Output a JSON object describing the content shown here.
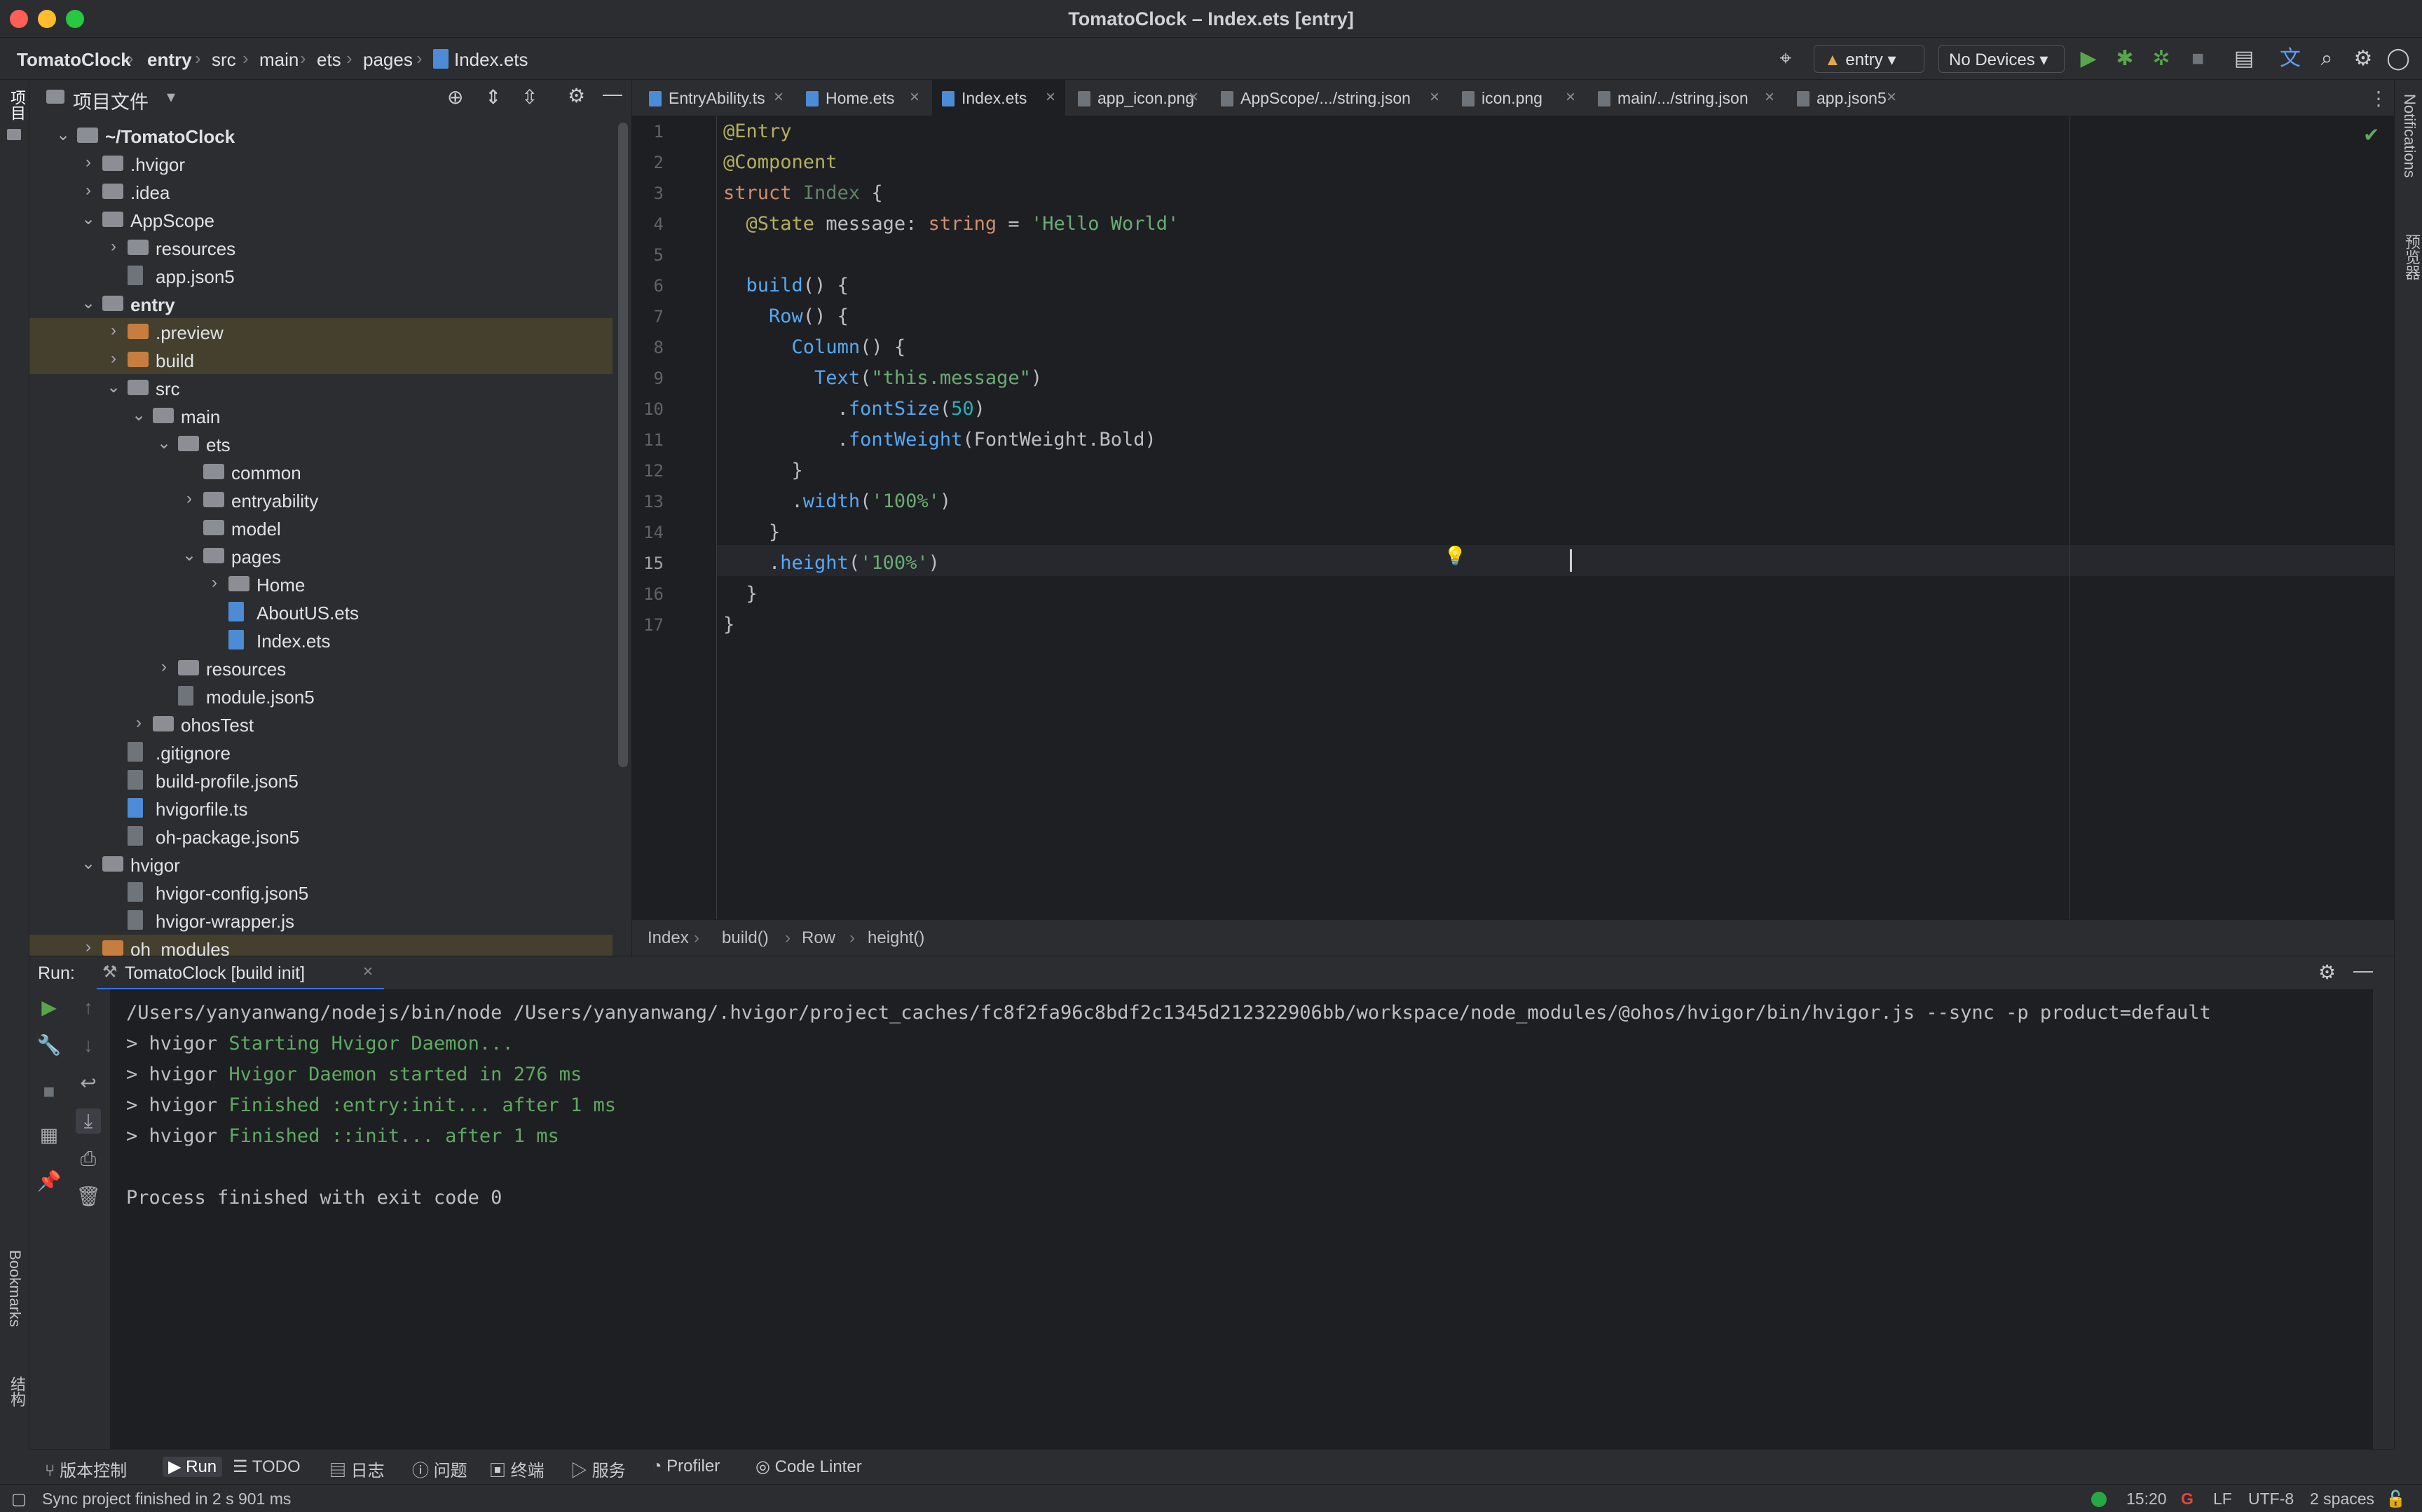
{
  "window": {
    "title": "TomatoClock – Index.ets [entry]"
  },
  "navbar": {
    "breadcrumbs": [
      "TomatoClock",
      "entry",
      "src",
      "main",
      "ets",
      "pages",
      "Index.ets"
    ],
    "run_config": "entry",
    "device": "No Devices"
  },
  "left_strip": {
    "project": "项目",
    "bookmarks": "Bookmarks",
    "structure": "结构"
  },
  "right_strip": {
    "notifications": "Notifications",
    "preview": "预览器"
  },
  "project": {
    "title": "项目文件",
    "tree": [
      {
        "label": "~/TomatoClock",
        "depth": 0,
        "type": "folder",
        "open": true,
        "bold": true
      },
      {
        "label": ".hvigor",
        "depth": 1,
        "type": "folder",
        "open": false
      },
      {
        "label": ".idea",
        "depth": 1,
        "type": "folder",
        "open": false
      },
      {
        "label": "AppScope",
        "depth": 1,
        "type": "folder",
        "open": true
      },
      {
        "label": "resources",
        "depth": 2,
        "type": "folder",
        "open": false
      },
      {
        "label": "app.json5",
        "depth": 2,
        "type": "file"
      },
      {
        "label": "entry",
        "depth": 1,
        "type": "folder",
        "open": true,
        "bold": true
      },
      {
        "label": ".preview",
        "depth": 2,
        "type": "folder",
        "open": false,
        "orange": true,
        "hl": true
      },
      {
        "label": "build",
        "depth": 2,
        "type": "folder",
        "open": false,
        "orange": true,
        "hl": true
      },
      {
        "label": "src",
        "depth": 2,
        "type": "folder",
        "open": true
      },
      {
        "label": "main",
        "depth": 3,
        "type": "folder",
        "open": true
      },
      {
        "label": "ets",
        "depth": 4,
        "type": "folder",
        "open": true
      },
      {
        "label": "common",
        "depth": 5,
        "type": "folder"
      },
      {
        "label": "entryability",
        "depth": 5,
        "type": "folder",
        "open": false
      },
      {
        "label": "model",
        "depth": 5,
        "type": "folder"
      },
      {
        "label": "pages",
        "depth": 5,
        "type": "folder",
        "open": true
      },
      {
        "label": "Home",
        "depth": 6,
        "type": "folder",
        "open": false
      },
      {
        "label": "AboutUS.ets",
        "depth": 6,
        "type": "file",
        "ets": true
      },
      {
        "label": "Index.ets",
        "depth": 6,
        "type": "file",
        "ets": true
      },
      {
        "label": "resources",
        "depth": 4,
        "type": "folder",
        "open": false
      },
      {
        "label": "module.json5",
        "depth": 4,
        "type": "file"
      },
      {
        "label": "ohosTest",
        "depth": 3,
        "type": "folder",
        "open": false
      },
      {
        "label": ".gitignore",
        "depth": 2,
        "type": "file"
      },
      {
        "label": "build-profile.json5",
        "depth": 2,
        "type": "file"
      },
      {
        "label": "hvigorfile.ts",
        "depth": 2,
        "type": "file",
        "ets": true
      },
      {
        "label": "oh-package.json5",
        "depth": 2,
        "type": "file"
      },
      {
        "label": "hvigor",
        "depth": 1,
        "type": "folder",
        "open": true
      },
      {
        "label": "hvigor-config.json5",
        "depth": 2,
        "type": "file"
      },
      {
        "label": "hvigor-wrapper.js",
        "depth": 2,
        "type": "file"
      },
      {
        "label": "oh_modules",
        "depth": 1,
        "type": "folder",
        "open": false,
        "orange": true,
        "hl": true
      }
    ]
  },
  "editor": {
    "tabs": [
      {
        "label": "EntryAbility.ts",
        "ets": true
      },
      {
        "label": "Home.ets",
        "ets": true
      },
      {
        "label": "Index.ets",
        "ets": true,
        "active": true
      },
      {
        "label": "app_icon.png"
      },
      {
        "label": "AppScope/.../string.json"
      },
      {
        "label": "icon.png"
      },
      {
        "label": "main/.../string.json"
      },
      {
        "label": "app.json5"
      }
    ],
    "current_line": 15,
    "lines": [
      [
        [
          "ann",
          "@Entry"
        ]
      ],
      [
        [
          "ann",
          "@Component"
        ]
      ],
      [
        [
          "kw",
          "struct "
        ],
        [
          "dim",
          "Index "
        ],
        [
          "cls",
          "{"
        ]
      ],
      [
        [
          "cls",
          "  "
        ],
        [
          "ann",
          "@State "
        ],
        [
          "cls",
          "message: "
        ],
        [
          "typ",
          "string"
        ],
        [
          "cls",
          " = "
        ],
        [
          "str",
          "'Hello World'"
        ]
      ],
      [],
      [
        [
          "cls",
          "  "
        ],
        [
          "fn",
          "build"
        ],
        [
          "cls",
          "() {"
        ]
      ],
      [
        [
          "cls",
          "    "
        ],
        [
          "fn",
          "Row"
        ],
        [
          "cls",
          "() {"
        ]
      ],
      [
        [
          "cls",
          "      "
        ],
        [
          "fn",
          "Column"
        ],
        [
          "cls",
          "() {"
        ]
      ],
      [
        [
          "cls",
          "        "
        ],
        [
          "fn",
          "Text"
        ],
        [
          "cls",
          "("
        ],
        [
          "str",
          "\"this.message\""
        ],
        [
          "cls",
          ")"
        ]
      ],
      [
        [
          "cls",
          "          ."
        ],
        [
          "fn",
          "fontSize"
        ],
        [
          "cls",
          "("
        ],
        [
          "num",
          "50"
        ],
        [
          "cls",
          ")"
        ]
      ],
      [
        [
          "cls",
          "          ."
        ],
        [
          "fn",
          "fontWeight"
        ],
        [
          "cls",
          "(FontWeight."
        ],
        [
          "cls",
          "Bold"
        ],
        [
          "cls",
          ")"
        ]
      ],
      [
        [
          "cls",
          "      }"
        ]
      ],
      [
        [
          "cls",
          "      ."
        ],
        [
          "fn",
          "width"
        ],
        [
          "cls",
          "("
        ],
        [
          "str",
          "'100%'"
        ],
        [
          "cls",
          ")"
        ]
      ],
      [
        [
          "cls",
          "    }"
        ]
      ],
      [
        [
          "cls",
          "    ."
        ],
        [
          "fn",
          "height"
        ],
        [
          "cls",
          "("
        ],
        [
          "str",
          "'100%'"
        ],
        [
          "cls",
          ")"
        ]
      ],
      [
        [
          "cls",
          "  }"
        ]
      ],
      [
        [
          "cls",
          "}"
        ]
      ]
    ],
    "breadcrumb": [
      "Index",
      "build()",
      "Row",
      "height()"
    ]
  },
  "run": {
    "label": "Run:",
    "tab": "TomatoClock [build init]",
    "console": [
      {
        "prefix": "",
        "text": "/Users/yanyanwang/nodejs/bin/node /Users/yanyanwang/.hvigor/project_caches/fc8f2fa96c8bdf2c1345d212322906bb/workspace/node_modules/@ohos/hvigor/bin/hvigor.js --sync -p product=default"
      },
      {
        "prefix": "> hvigor ",
        "text": "Starting Hvigor Daemon..."
      },
      {
        "prefix": "> hvigor ",
        "text": "Hvigor Daemon started in 276 ms"
      },
      {
        "prefix": "> hvigor ",
        "text": "Finished :entry:init... after 1 ms"
      },
      {
        "prefix": "> hvigor ",
        "text": "Finished ::init... after 1 ms"
      },
      {
        "prefix": "",
        "text": ""
      },
      {
        "prefix": "",
        "text": "Process finished with exit code 0"
      }
    ]
  },
  "bottom_tools": [
    {
      "label": "版本控制"
    },
    {
      "label": "Run",
      "active": true
    },
    {
      "label": "TODO"
    },
    {
      "label": "日志"
    },
    {
      "label": "问题"
    },
    {
      "label": "终端"
    },
    {
      "label": "服务"
    },
    {
      "label": "Profiler"
    },
    {
      "label": "Code Linter"
    }
  ],
  "status": {
    "message": "Sync project finished in 2 s 901 ms",
    "position": "15:20",
    "line_sep": "LF",
    "encoding": "UTF-8",
    "indent": "2 spaces"
  },
  "colors": {
    "accent": "#3574f0",
    "folder_excluded": "#c77d3f",
    "run_green": "#5faa62"
  }
}
